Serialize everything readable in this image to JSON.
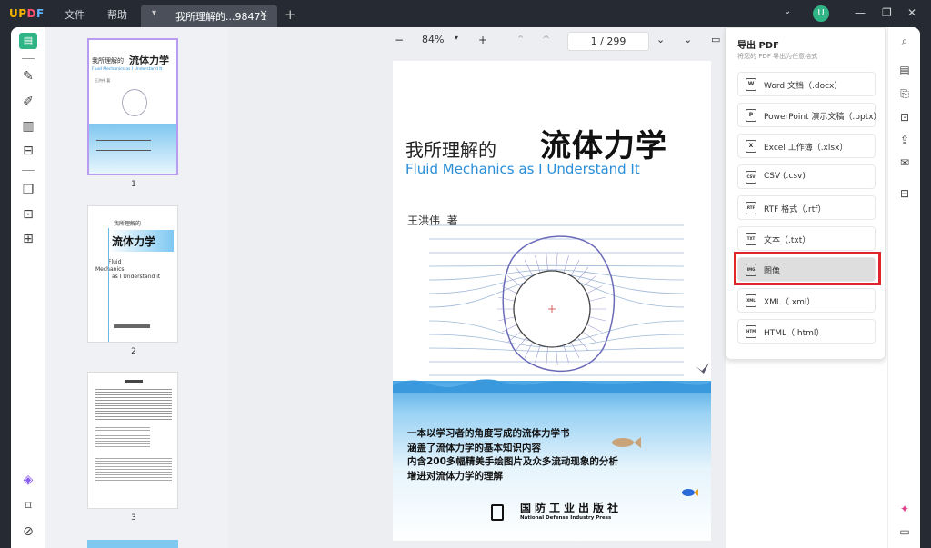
{
  "brand": {
    "name": "UPDF"
  },
  "menu": [
    "文件",
    "帮助"
  ],
  "tab": {
    "title": "我所理解的...98471",
    "close": "×"
  },
  "window_controls": {
    "minimize": "—",
    "restore": "❐",
    "close": "✕"
  },
  "user": {
    "initial": "U"
  },
  "thumbnails": [
    {
      "number": "1"
    },
    {
      "number": "2"
    },
    {
      "number": "3"
    }
  ],
  "thumb1": {
    "title_small": "我所理解的",
    "title_big": "流体力学",
    "subtitle": "Fluid Mechanics as I Understand It",
    "author": "王洪伟 著"
  },
  "thumb2": {
    "title_small": "我所理解的",
    "title_big": "流体力学",
    "en1": "Fluid",
    "en2": "Mechanics",
    "en3": "as I Understand it"
  },
  "toolbar": {
    "zoom": "84%",
    "zoom_out": "−",
    "zoom_in": "+",
    "current_page": "1",
    "page_sep": "/",
    "total_pages": "299"
  },
  "book": {
    "title_small": "我所理解的",
    "title_big": "流体力学",
    "subtitle": "Fluid Mechanics as I Understand It",
    "author": "王洪伟  著",
    "lines": [
      "一本以学习者的角度写成的流体力学书",
      "涵盖了流体力学的基本知识内容",
      "内含200多幅精美手绘图片及众多流动现象的分析",
      "增进对流体力学的理解"
    ],
    "publisher_cn": "国防工业出版社",
    "publisher_en": "National Defense Industry Press"
  },
  "export": {
    "title": "导出 PDF",
    "subtitle": "将您的 PDF 导出为任意格式",
    "items": [
      {
        "label": "Word 文档（.docx）",
        "icon": "W"
      },
      {
        "label": "PowerPoint 演示文稿（.pptx）",
        "icon": "P"
      },
      {
        "label": "Excel 工作簿（.xlsx）",
        "icon": "X"
      },
      {
        "label": "CSV (.csv)",
        "icon": "CSV"
      },
      {
        "label": "RTF 格式（.rtf）",
        "icon": "RTF"
      },
      {
        "label": "文本（.txt）",
        "icon": "TXT"
      },
      {
        "label": "图像",
        "icon": "IMG"
      },
      {
        "label": "XML（.xml）",
        "icon": "XML"
      },
      {
        "label": "HTML（.html）",
        "icon": "HTM"
      }
    ]
  },
  "colors": {
    "accent": "#2fb585",
    "highlight_box": "#e0232d",
    "selected_thumb": "#b79cf2",
    "subtitle_blue": "#2a8fd8"
  }
}
